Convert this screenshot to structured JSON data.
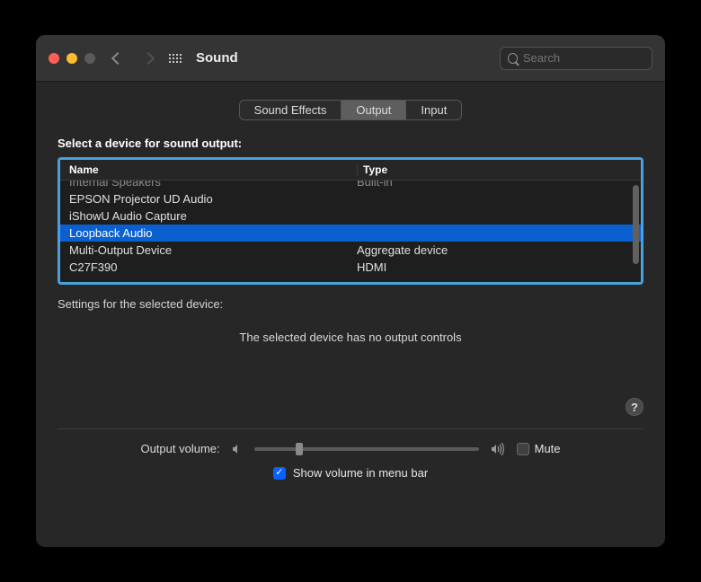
{
  "header": {
    "title": "Sound",
    "search_placeholder": "Search"
  },
  "tabs": {
    "items": [
      "Sound Effects",
      "Output",
      "Input"
    ],
    "active_index": 1
  },
  "section": {
    "select_label": "Select a device for sound output:",
    "columns": {
      "name": "Name",
      "type": "Type"
    },
    "devices": [
      {
        "name": "Internal Speakers",
        "type": "Built-in",
        "selected": false,
        "partial": true
      },
      {
        "name": "EPSON Projector UD Audio",
        "type": "",
        "selected": false
      },
      {
        "name": "iShowU Audio Capture",
        "type": "",
        "selected": false
      },
      {
        "name": "Loopback Audio",
        "type": "",
        "selected": true
      },
      {
        "name": "Multi-Output Device",
        "type": "Aggregate device",
        "selected": false
      },
      {
        "name": "C27F390",
        "type": "HDMI",
        "selected": false
      }
    ],
    "settings_label": "Settings for the selected device:",
    "no_controls": "The selected device has no output controls"
  },
  "volume": {
    "label": "Output volume:",
    "mute_label": "Mute",
    "mute_checked": false,
    "menubar_label": "Show volume in menu bar",
    "menubar_checked": true,
    "position": 0.18
  },
  "help_label": "?"
}
